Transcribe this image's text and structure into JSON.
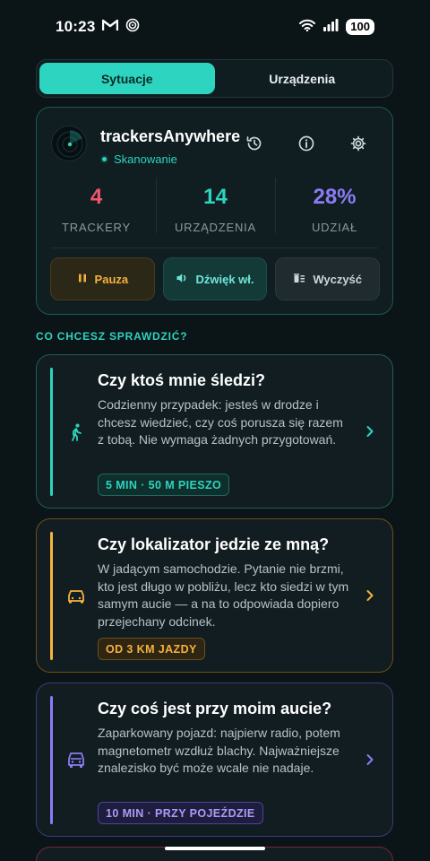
{
  "status_bar": {
    "time": "10:23",
    "battery": "100"
  },
  "tabs": [
    {
      "label": "Sytuacje",
      "active": true
    },
    {
      "label": "Urządzenia",
      "active": false
    }
  ],
  "status_card": {
    "app_name": "trackersAnywhere",
    "scan_status": "Skanowanie",
    "header_icons": [
      "history-icon",
      "info-icon",
      "settings-icon"
    ],
    "stats": [
      {
        "value": "4",
        "label": "TRACKERY",
        "color": "#f0566f"
      },
      {
        "value": "14",
        "label": "URZĄDZENIA",
        "color": "#2dd4bf"
      },
      {
        "value": "28%",
        "label": "UDZIAŁ",
        "color": "#8b7cf6"
      }
    ],
    "actions": [
      {
        "label": "Pauza",
        "icon": "pause-icon"
      },
      {
        "label": "Dźwięk wł.",
        "icon": "speaker-icon"
      },
      {
        "label": "Wyczyść",
        "icon": "clear-list-icon"
      }
    ]
  },
  "section_title": "CO CHCESZ SPRAWDZIĆ?",
  "scenarios": [
    {
      "title": "Czy ktoś mnie śledzi?",
      "description": "Codzienny przypadek: jesteś w drodze i chcesz wiedzieć, czy coś porusza się razem z tobą. Nie wymaga żadnych przygotowań.",
      "tag": "5 MIN · 50 M PIESZO",
      "icon": "walking-icon",
      "accent": "#2dd4bf"
    },
    {
      "title": "Czy lokalizator jedzie ze mną?",
      "description": "W jadącym samochodzie. Pytanie nie brzmi, kto jest długo w pobliżu, lecz kto siedzi w tym samym aucie — a na to odpowiada dopiero przejechany odcinek.",
      "tag": "OD 3 KM JAZDY",
      "icon": "car-icon",
      "accent": "#f5b23c"
    },
    {
      "title": "Czy coś jest przy moim aucie?",
      "description": "Zaparkowany pojazd: najpierw radio, potem magnetometr wzdłuż blachy. Najważniejsze znalezisko być może wcale nie nadaje.",
      "tag": "10 MIN · PRZY POJEŹDZIE",
      "icon": "parked-car-icon",
      "accent": "#8b7cf6"
    }
  ]
}
